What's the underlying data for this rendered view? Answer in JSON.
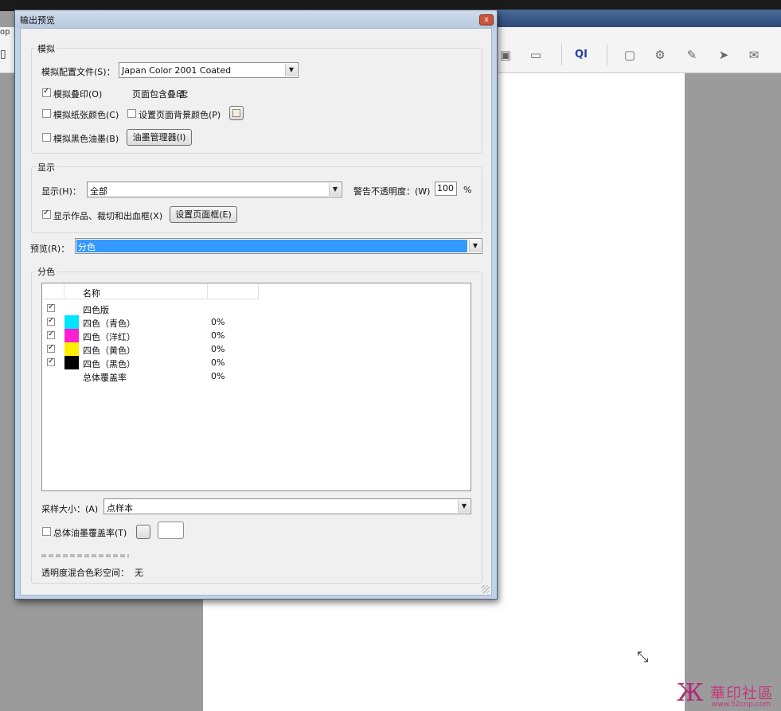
{
  "app": {
    "tab_fragment": "op",
    "toolbar_icons": [
      "save-page-icon",
      "ruler-icon",
      "qi-icon",
      "shield-doc-icon",
      "gear-doc-icon",
      "pen-icon",
      "pointer-icon",
      "mail-icon"
    ],
    "qi_label": "QI"
  },
  "dialog": {
    "title": "输出预览",
    "close_glyph": "x",
    "simulate": {
      "group_title": "模拟",
      "profile_label": "模拟配置文件(S)：",
      "profile_value": "Japan Color 2001 Coated",
      "overprint_label": "模拟叠印(O)",
      "overprint_checked": true,
      "page_overprint_label": "页面包含叠印：",
      "page_overprint_value": "否",
      "paper_color_label": "模拟纸张颜色(C)",
      "paper_color_checked": false,
      "page_bg_label": "设置页面背景颜色(P)",
      "page_bg_checked": false,
      "black_ink_label": "模拟黑色油墨(B)",
      "black_ink_checked": false,
      "ink_manager_label": "油墨管理器(I)"
    },
    "display": {
      "group_title": "显示",
      "show_label": "显示(H)：",
      "show_value": "全部",
      "warning_opacity_label": "警告不透明度：(W)",
      "warning_opacity_value": "100",
      "percent": "%",
      "show_boxes_label": "显示作品、裁切和出血框(X)",
      "show_boxes_checked": true,
      "set_page_box_label": "设置页面框(E)"
    },
    "preview": {
      "label": "预览(R)：",
      "value": "分色"
    },
    "separations": {
      "group_title": "分色",
      "col_name": "名称",
      "rows": [
        {
          "name": "四色版",
          "checked": true,
          "color": "",
          "pct": ""
        },
        {
          "name": "四色（青色）",
          "checked": true,
          "color": "#00e5ff",
          "pct": "0%"
        },
        {
          "name": "四色（洋红）",
          "checked": true,
          "color": "#ff1fd2",
          "pct": "0%"
        },
        {
          "name": "四色（黄色）",
          "checked": true,
          "color": "#ffee00",
          "pct": "0%"
        },
        {
          "name": "四色（黑色）",
          "checked": true,
          "color": "#000000",
          "pct": "0%"
        },
        {
          "name": "总体覆盖率",
          "checked": false,
          "color": "",
          "pct": "0%"
        }
      ],
      "sample_size_label": "采样大小：(A)",
      "sample_size_value": "点样本",
      "total_coverage_label": "总体油墨覆盖率(T)",
      "total_coverage_checked": false,
      "blend_space_label": "透明度混合色彩空间：",
      "blend_space_value": "无"
    }
  },
  "watermark": {
    "text": "華印社區",
    "url": "www.52cnp.com"
  }
}
